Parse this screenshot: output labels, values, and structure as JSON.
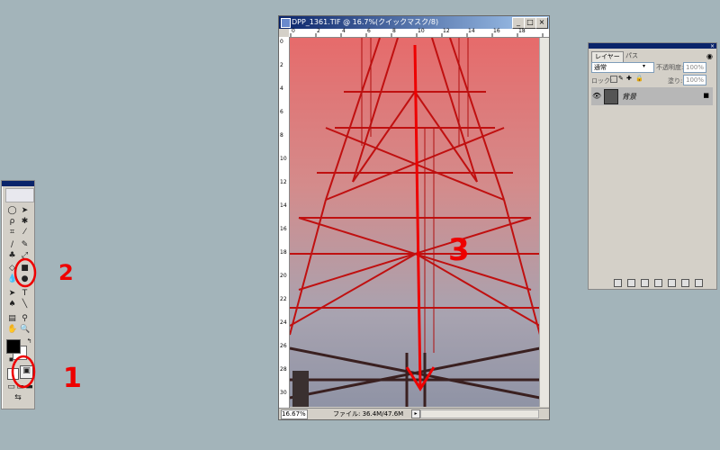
{
  "document": {
    "title": "DPP_1361.TIF @ 16.7%(クイックマスク/8)",
    "zoom": "16.67%",
    "file_info": "ファイル: 36.4M/47.6M",
    "ruler_top": [
      "0",
      "2",
      "4",
      "6",
      "8",
      "10",
      "12",
      "14",
      "16",
      "18"
    ],
    "ruler_left": [
      "0",
      "2",
      "4",
      "6",
      "8",
      "10",
      "12",
      "14",
      "16",
      "18",
      "20",
      "22",
      "24",
      "26",
      "28",
      "30"
    ]
  },
  "layers_panel": {
    "tabs": [
      "レイヤー",
      "パス"
    ],
    "blend_mode": "通常",
    "opacity_label": "不透明度:",
    "opacity_value": "100%",
    "lock_label": "ロック:",
    "fill_label": "塗り:",
    "fill_value": "100%",
    "layer_name": "背景"
  },
  "annotations": {
    "one": "1",
    "two": "2",
    "three": "3"
  },
  "colors": {
    "foreground": "#000000",
    "background": "#ffffff",
    "annotation": "#ee0000"
  }
}
